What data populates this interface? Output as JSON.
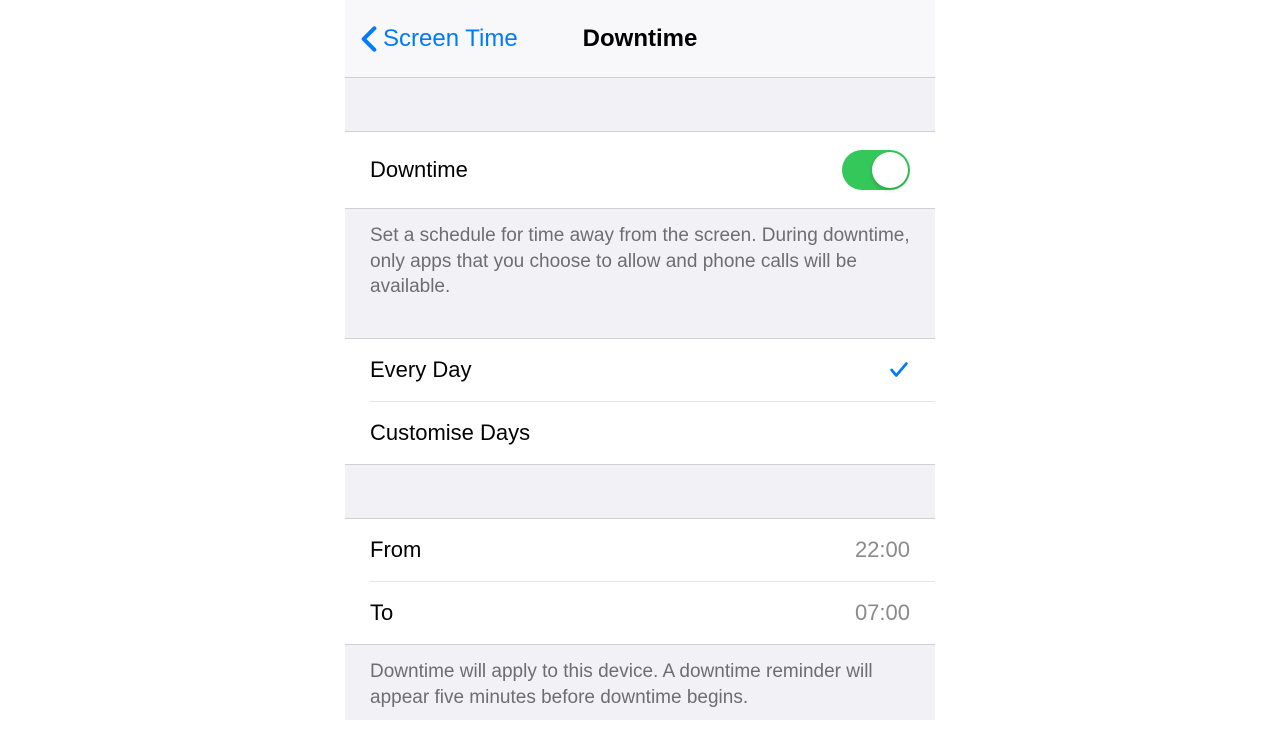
{
  "nav": {
    "back_label": "Screen Time",
    "title": "Downtime"
  },
  "downtime_toggle": {
    "label": "Downtime",
    "enabled": true,
    "description": "Set a schedule for time away from the screen. During downtime, only apps that you choose to allow and phone calls will be available."
  },
  "schedule_mode": {
    "every_day_label": "Every Day",
    "customise_label": "Customise Days",
    "selected": "every_day"
  },
  "time_range": {
    "from_label": "From",
    "from_value": "22:00",
    "to_label": "To",
    "to_value": "07:00",
    "footer": "Downtime will apply to this device. A downtime reminder will appear five minutes before downtime begins."
  },
  "colors": {
    "tint": "#007aff",
    "toggle_on": "#34c759"
  }
}
